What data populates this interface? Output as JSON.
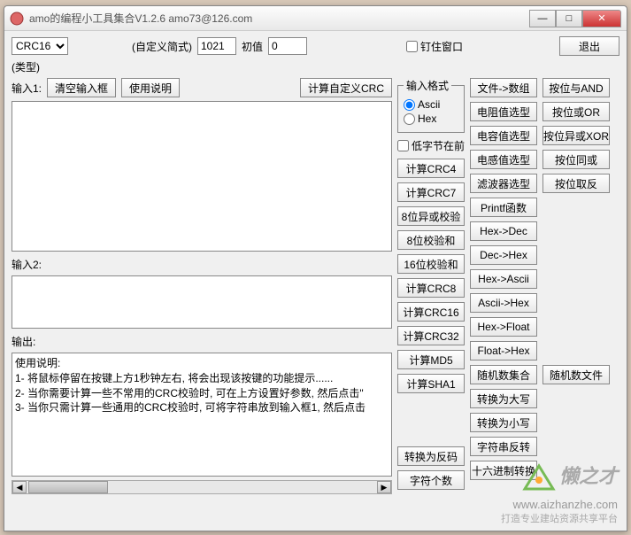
{
  "titlebar": {
    "title": "amo的编程小工具集合V1.2.6 amo73@126.com"
  },
  "top": {
    "select_value": "CRC16",
    "custom_label": "(自定义简式)",
    "custom_val": "1021",
    "init_label": "初值",
    "init_val": "0",
    "pin_label": "钉住窗口",
    "exit": "退出",
    "type_label": "(类型)"
  },
  "left": {
    "input1_label": "输入1:",
    "clear_btn": "清空输入框",
    "help_btn": "使用说明",
    "calc_custom": "计算自定义CRC",
    "input2_label": "输入2:",
    "output_label": "输出:",
    "output_text": "使用说明:\n1- 将鼠标停留在按键上方1秒钟左右, 将会出现该按键的功能提示......\n2- 当你需要计算一些不常用的CRC校验时, 可在上方设置好参数, 然后点击\"\n3- 当你只需计算一些通用的CRC校验时, 可将字符串放到输入框1, 然后点击"
  },
  "mid": {
    "input_format": "输入格式",
    "ascii": "Ascii",
    "hex": "Hex",
    "lowbyte": "低字节在前",
    "buttons": [
      "计算CRC4",
      "计算CRC7",
      "8位异或校验",
      "8位校验和",
      "16位校验和",
      "计算CRC8",
      "计算CRC16",
      "计算CRC32",
      "计算MD5",
      "计算SHA1"
    ],
    "buttons2": [
      "转换为反码",
      "字符个数"
    ]
  },
  "col2": [
    "文件->数组",
    "电阻值选型",
    "电容值选型",
    "电感值选型",
    "滤波器选型",
    "Printf函数",
    "Hex->Dec",
    "Dec->Hex",
    "Hex->Ascii",
    "Ascii->Hex",
    "Hex->Float",
    "Float->Hex",
    "随机数集合",
    "转换为大写",
    "转换为小写",
    "字符串反转",
    "十六进制转换"
  ],
  "col3": [
    "按位与AND",
    "按位或OR",
    "按位异或XOR",
    "按位同或",
    "按位取反",
    "",
    "",
    "",
    "",
    "",
    "",
    "",
    "随机数文件"
  ],
  "watermark": {
    "brand": "懒之才",
    "url": "www.aizhanzhe.com",
    "sub": "打造专业建站资源共享平台"
  }
}
